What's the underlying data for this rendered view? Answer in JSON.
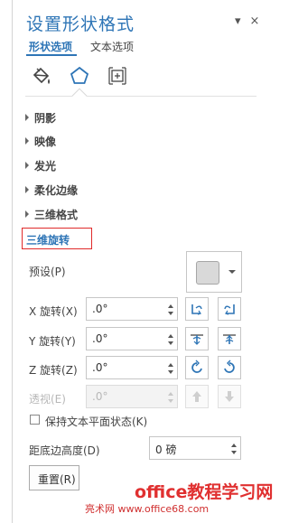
{
  "pane": {
    "title": "设置形状格式",
    "pin_glyph": "▾",
    "close_glyph": "×",
    "tabs": {
      "shape_options": "形状选项",
      "text_options": "文本选项"
    },
    "icon_tabs": [
      "fill-line-icon",
      "effects-icon",
      "size-properties-icon"
    ]
  },
  "sections": [
    "阴影",
    "映像",
    "发光",
    "柔化边缘",
    "三维格式",
    "三维旋转"
  ],
  "rotation": {
    "preset_label": "预设(P)",
    "x_label": "X 旋转(X)",
    "x_value": ".0°",
    "y_label": "Y 旋转(Y)",
    "y_value": ".0°",
    "z_label": "Z 旋转(Z)",
    "z_value": ".0°",
    "perspective_label": "透视(E)",
    "perspective_value": ".0°",
    "keep_text_flat_label": "保持文本平面状态(K)",
    "distance_label": "距底边高度(D)",
    "distance_value": "0 磅",
    "reset_label": "重置(R)"
  },
  "watermark": {
    "line1": "office教程学习网",
    "line2": "亮术网 www.office68.com"
  },
  "colors": {
    "accent": "#2e75b6",
    "highlight_border": "#e02a2a",
    "watermark": "#e03030"
  }
}
